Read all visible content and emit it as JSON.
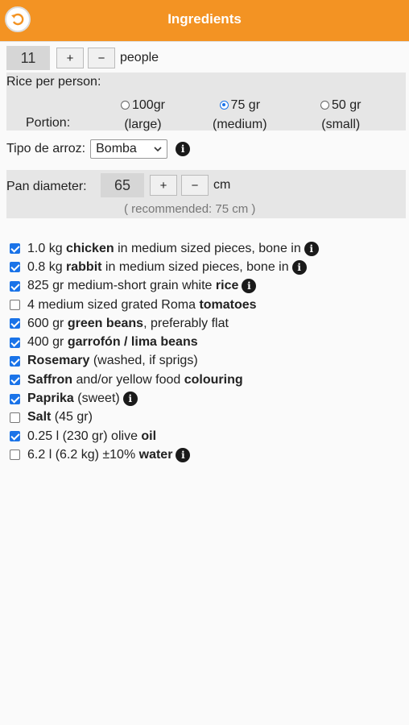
{
  "header": {
    "title": "Ingredients",
    "back_icon": "back-arrow-icon"
  },
  "people": {
    "value": "11",
    "plus": "+",
    "minus": "−",
    "unit": "people"
  },
  "rice": {
    "label": "Rice per person:",
    "portion_label": "Portion:",
    "options": [
      {
        "amount": "100gr",
        "desc": "(large)",
        "selected": false
      },
      {
        "amount": "75 gr",
        "desc": "(medium)",
        "selected": true
      },
      {
        "amount": "50 gr",
        "desc": "(small)",
        "selected": false
      }
    ]
  },
  "rice_type": {
    "label": "Tipo de arroz:",
    "value": "Bomba",
    "chevron": "chevron-down-icon"
  },
  "pan": {
    "label": "Pan diameter:",
    "value": "65",
    "plus": "+",
    "minus": "−",
    "unit": "cm",
    "recommended": "( recommended:  75 cm )"
  },
  "ingredients": [
    {
      "checked": true,
      "parts": [
        [
          "1.0 kg ",
          false
        ],
        [
          "chicken",
          true
        ],
        [
          " in medium sized pieces, bone in",
          false
        ]
      ],
      "info": true
    },
    {
      "checked": true,
      "parts": [
        [
          "0.8 kg ",
          false
        ],
        [
          "rabbit",
          true
        ],
        [
          " in medium sized pieces, bone in",
          false
        ]
      ],
      "info": true
    },
    {
      "checked": true,
      "parts": [
        [
          "825 gr medium-short grain white ",
          false
        ],
        [
          "rice",
          true
        ]
      ],
      "info": true
    },
    {
      "checked": false,
      "parts": [
        [
          "4 medium sized grated Roma ",
          false
        ],
        [
          "tomatoes",
          true
        ]
      ],
      "info": false
    },
    {
      "checked": true,
      "parts": [
        [
          "600 gr ",
          false
        ],
        [
          "green beans",
          true
        ],
        [
          ", preferably flat",
          false
        ]
      ],
      "info": false
    },
    {
      "checked": true,
      "parts": [
        [
          "400 gr ",
          false
        ],
        [
          "garrofón / lima beans",
          true
        ]
      ],
      "info": false
    },
    {
      "checked": true,
      "parts": [
        [
          "Rosemary",
          true
        ],
        [
          " (washed, if sprigs)",
          false
        ]
      ],
      "info": false
    },
    {
      "checked": true,
      "parts": [
        [
          "Saffron",
          true
        ],
        [
          " and/or yellow food ",
          false
        ],
        [
          "colouring",
          true
        ]
      ],
      "info": false
    },
    {
      "checked": true,
      "parts": [
        [
          "Paprika",
          true
        ],
        [
          " (sweet)",
          false
        ]
      ],
      "info": true
    },
    {
      "checked": false,
      "parts": [
        [
          "Salt",
          true
        ],
        [
          " (45 gr)",
          false
        ]
      ],
      "info": false
    },
    {
      "checked": true,
      "parts": [
        [
          "0.25 l (230 gr) olive ",
          false
        ],
        [
          "oil",
          true
        ]
      ],
      "info": false
    },
    {
      "checked": false,
      "parts": [
        [
          "6.2 l (6.2 kg) ±10% ",
          false
        ],
        [
          "water",
          true
        ]
      ],
      "info": true
    }
  ],
  "colors": {
    "accent": "#f39323",
    "checkbox": "#1a73e8",
    "panel": "#e6e6e6"
  }
}
